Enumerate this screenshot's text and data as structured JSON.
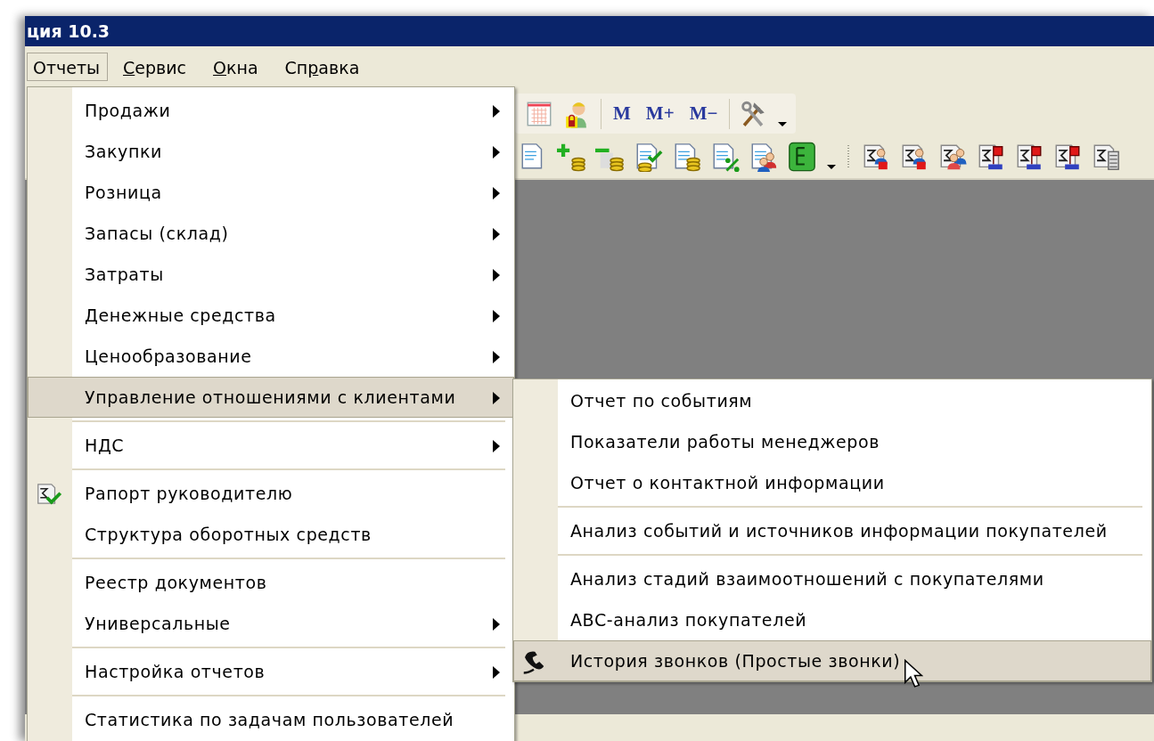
{
  "window": {
    "title": "ция 10.3"
  },
  "menubar": [
    {
      "selected": true,
      "text_parts": [
        {
          "text": "Отчеты",
          "underlined": false
        }
      ]
    },
    {
      "selected": false,
      "text_parts": [
        {
          "text": "С",
          "underlined": true
        },
        {
          "text": "ервис",
          "underlined": false
        }
      ]
    },
    {
      "selected": false,
      "text_parts": [
        {
          "text": "О",
          "underlined": true
        },
        {
          "text": "кна",
          "underlined": false
        }
      ]
    },
    {
      "selected": false,
      "text_parts": [
        {
          "text": "Сп",
          "underlined": false
        },
        {
          "text": "р",
          "underlined": true
        },
        {
          "text": "авка",
          "underlined": false
        }
      ]
    }
  ],
  "toolbar_1": [
    {
      "kind": "calendar"
    },
    {
      "kind": "user-lock"
    },
    {
      "kind": "separator"
    },
    {
      "kind": "text",
      "label": "M"
    },
    {
      "kind": "text",
      "label": "M+"
    },
    {
      "kind": "text",
      "label": "M−"
    },
    {
      "kind": "separator"
    },
    {
      "kind": "tools"
    },
    {
      "kind": "dropdown"
    }
  ],
  "toolbar_2": [
    {
      "kind": "doc"
    },
    {
      "kind": "doc-plus"
    },
    {
      "kind": "doc-minus"
    },
    {
      "kind": "doc-check"
    },
    {
      "kind": "doc-coins"
    },
    {
      "kind": "doc-percent"
    },
    {
      "kind": "doc-users"
    },
    {
      "kind": "tree"
    },
    {
      "kind": "dropdown"
    },
    {
      "kind": "grip"
    },
    {
      "kind": "sum-user"
    },
    {
      "kind": "sum-user"
    },
    {
      "kind": "sum-users"
    },
    {
      "kind": "sum-flag"
    },
    {
      "kind": "sum-flag"
    },
    {
      "kind": "sum-flag"
    },
    {
      "kind": "sum-list"
    }
  ],
  "reports_menu": [
    {
      "kind": "item",
      "label": "Продажи",
      "has_submenu": true,
      "selected": false
    },
    {
      "kind": "item",
      "label": "Закупки",
      "has_submenu": true,
      "selected": false
    },
    {
      "kind": "item",
      "label": "Розница",
      "has_submenu": true,
      "selected": false
    },
    {
      "kind": "item",
      "label": "Запасы (склад)",
      "has_submenu": true,
      "selected": false
    },
    {
      "kind": "item",
      "label": "Затраты",
      "has_submenu": true,
      "selected": false
    },
    {
      "kind": "item",
      "label": "Денежные средства",
      "has_submenu": true,
      "selected": false
    },
    {
      "kind": "item",
      "label": "Ценообразование",
      "has_submenu": true,
      "selected": false
    },
    {
      "kind": "item",
      "label": "Управление отношениями с клиентами",
      "has_submenu": true,
      "selected": true
    },
    {
      "kind": "separator"
    },
    {
      "kind": "item",
      "label": "НДС",
      "has_submenu": true,
      "selected": false
    },
    {
      "kind": "separator"
    },
    {
      "kind": "report-item",
      "label": "Рапорт руководителю",
      "has_submenu": false,
      "selected": false
    },
    {
      "kind": "item",
      "label": "Структура оборотных средств",
      "has_submenu": false,
      "selected": false
    },
    {
      "kind": "separator"
    },
    {
      "kind": "item",
      "label": "Реестр документов",
      "has_submenu": false,
      "selected": false
    },
    {
      "kind": "item",
      "label": "Универсальные",
      "has_submenu": true,
      "selected": false
    },
    {
      "kind": "separator"
    },
    {
      "kind": "item",
      "label": "Настройка отчетов",
      "has_submenu": true,
      "selected": false
    },
    {
      "kind": "separator"
    },
    {
      "kind": "item",
      "label": "Статистика по задачам пользователей",
      "has_submenu": false,
      "selected": false
    }
  ],
  "crm_submenu": [
    {
      "kind": "item",
      "label": "Отчет по событиям",
      "selected": false
    },
    {
      "kind": "item",
      "label": "Показатели работы менеджеров",
      "selected": false
    },
    {
      "kind": "item",
      "label": "Отчет о контактной информации",
      "selected": false
    },
    {
      "kind": "separator"
    },
    {
      "kind": "item",
      "label": "Анализ событий и источников информации покупателей",
      "selected": false
    },
    {
      "kind": "separator"
    },
    {
      "kind": "item",
      "label": "Анализ стадий взаимоотношений с покупателями",
      "selected": false
    },
    {
      "kind": "item",
      "label": "ABC-анализ покупателей",
      "selected": false
    },
    {
      "kind": "call-item",
      "label": "История звонков (Простые звонки)",
      "selected": true
    }
  ]
}
